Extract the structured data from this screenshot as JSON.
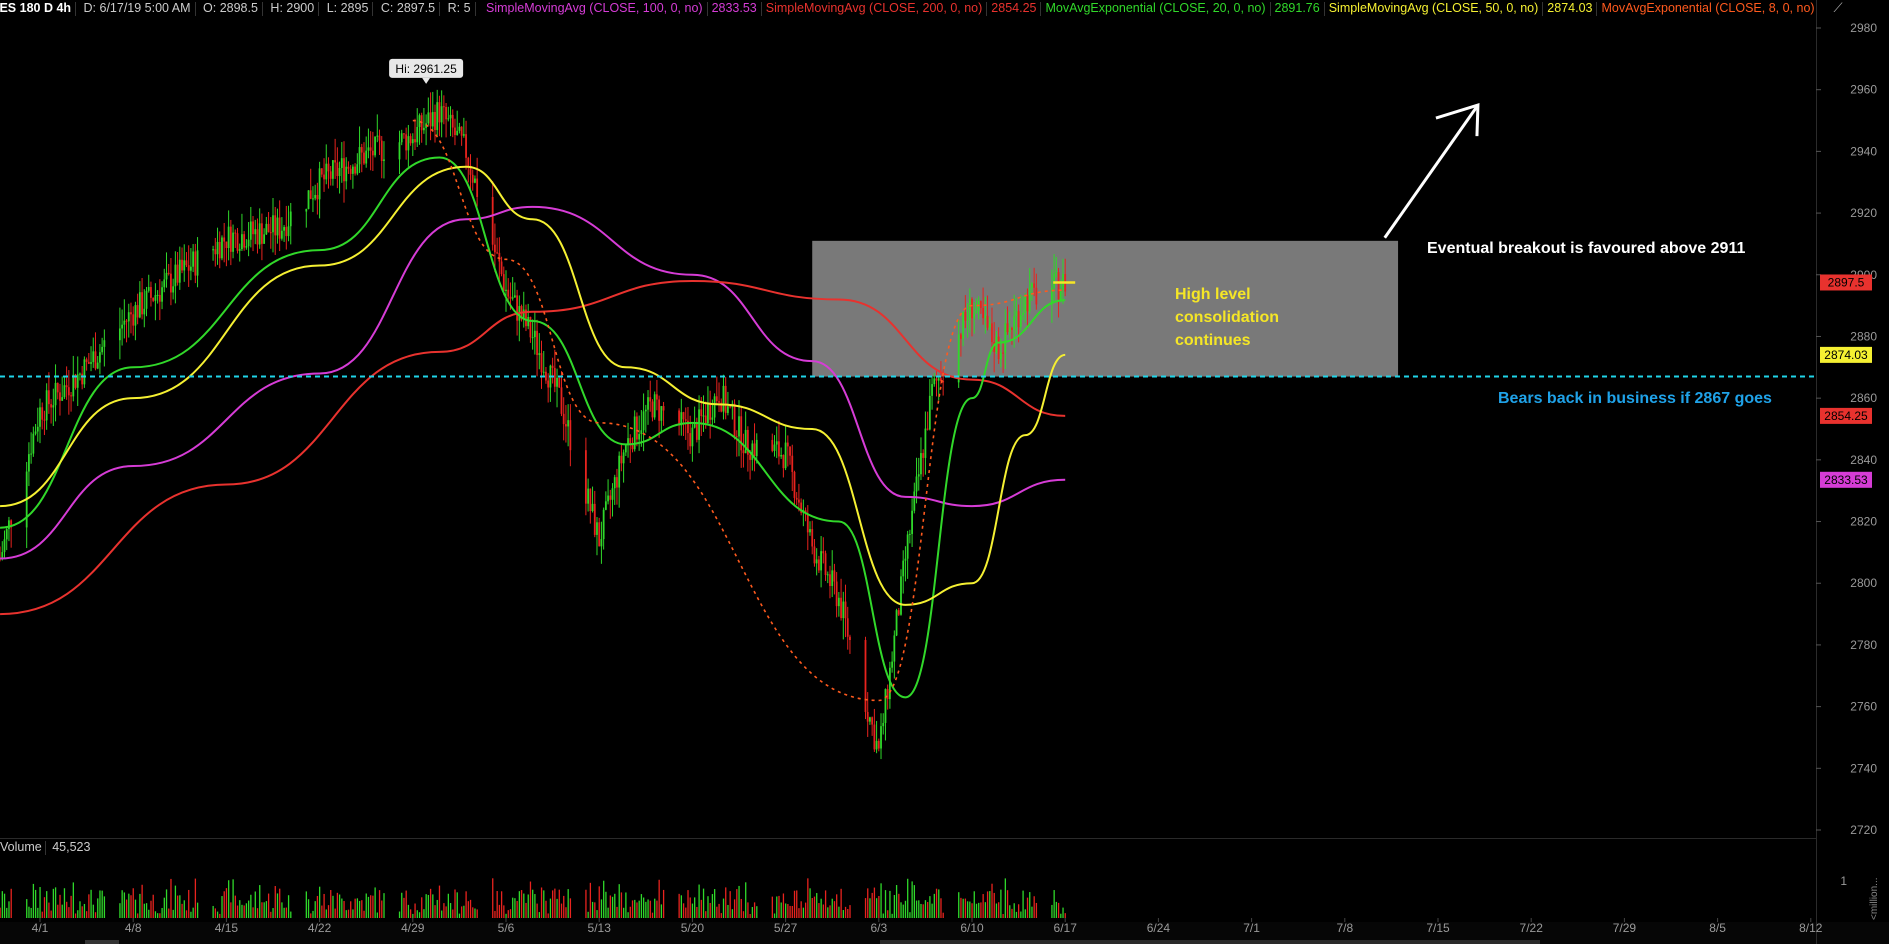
{
  "header": {
    "symbol": "/ES 180 D 4h",
    "date": "D: 6/17/19 5:00 AM",
    "open": "O: 2898.5",
    "high": "H: 2900",
    "low": "L: 2895",
    "close": "C: 2897.5",
    "range": "R: 5",
    "studies": [
      {
        "label": "SimpleMovingAvg (CLOSE, 100, 0, no)",
        "value": "2833.53",
        "color": "#d63cd6"
      },
      {
        "label": "SimpleMovingAvg (CLOSE, 200, 0, no)",
        "value": "2854.25",
        "color": "#e8322e"
      },
      {
        "label": "MovAvgExponential (CLOSE, 20, 0, no)",
        "value": "2891.76",
        "color": "#31d82a"
      },
      {
        "label": "SimpleMovingAvg (CLOSE, 50, 0, no)",
        "value": "2874.03",
        "color": "#f5f032"
      },
      {
        "label": "MovAvgExponential (CLOSE, 8, 0, no)",
        "value": "",
        "color": "#ff5a1e"
      }
    ]
  },
  "volume": {
    "label": "Volume",
    "value": "45,523",
    "unit": "<million..."
  },
  "colors": {
    "up": "#2fd82a",
    "down": "#e8231e",
    "zone": "#808080",
    "support": "#1fd4e8",
    "annotation": "#f5e626"
  },
  "chart_data": {
    "type": "candlestick",
    "timeframe": "4h",
    "ylim": [
      2720,
      2980
    ],
    "y_ticks": [
      2720,
      2740,
      2760,
      2780,
      2800,
      2820,
      2840,
      2860,
      2880,
      2900,
      2920,
      2940,
      2960,
      2980
    ],
    "x_tick_labels": [
      "4/1",
      "4/8",
      "4/15",
      "4/22",
      "4/29",
      "5/6",
      "5/13",
      "5/20",
      "5/27",
      "6/3",
      "6/10",
      "6/17",
      "6/24",
      "7/1",
      "7/8",
      "7/15",
      "7/22",
      "7/29",
      "8/5",
      "8/12"
    ],
    "price_path": {
      "dates": [
        "3/29",
        "4/1",
        "4/4",
        "4/8",
        "4/12",
        "4/15",
        "4/19",
        "4/22",
        "4/25",
        "4/29",
        "5/1",
        "5/3",
        "5/6",
        "5/8",
        "5/10",
        "5/13",
        "5/15",
        "5/17",
        "5/20",
        "5/22",
        "5/24",
        "5/27",
        "5/29",
        "5/31",
        "6/3",
        "6/5",
        "6/7",
        "6/10",
        "6/12",
        "6/14",
        "6/17"
      ],
      "close": [
        2808,
        2856,
        2868,
        2888,
        2902,
        2912,
        2915,
        2930,
        2938,
        2945,
        2953,
        2940,
        2895,
        2880,
        2860,
        2814,
        2845,
        2858,
        2848,
        2862,
        2845,
        2842,
        2812,
        2795,
        2745,
        2808,
        2862,
        2890,
        2876,
        2892,
        2897.5
      ]
    },
    "studies": [
      {
        "name": "SimpleMovingAvg (CLOSE, 100, 0, no)",
        "last": 2833.53,
        "points": [
          [
            "3/29",
            2808
          ],
          [
            "4/8",
            2838
          ],
          [
            "4/22",
            2868
          ],
          [
            "5/3",
            2918
          ],
          [
            "5/8",
            2922
          ],
          [
            "5/20",
            2900
          ],
          [
            "5/29",
            2872
          ],
          [
            "6/5",
            2828
          ],
          [
            "6/10",
            2825
          ],
          [
            "6/17",
            2833.53
          ]
        ]
      },
      {
        "name": "SimpleMovingAvg (CLOSE, 200, 0, no)",
        "last": 2854.25,
        "points": [
          [
            "3/29",
            2790
          ],
          [
            "4/15",
            2832
          ],
          [
            "5/1",
            2875
          ],
          [
            "5/8",
            2888
          ],
          [
            "5/20",
            2898
          ],
          [
            "5/31",
            2892
          ],
          [
            "6/10",
            2866
          ],
          [
            "6/17",
            2854.25
          ]
        ]
      },
      {
        "name": "MovAvgExponential (CLOSE, 20, 0, no)",
        "last": 2891.76,
        "points": [
          [
            "3/29",
            2818
          ],
          [
            "4/8",
            2870
          ],
          [
            "4/22",
            2908
          ],
          [
            "5/1",
            2938
          ],
          [
            "5/8",
            2885
          ],
          [
            "5/15",
            2845
          ],
          [
            "5/20",
            2852
          ],
          [
            "5/31",
            2820
          ],
          [
            "6/5",
            2763
          ],
          [
            "6/10",
            2860
          ],
          [
            "6/12",
            2878
          ],
          [
            "6/17",
            2891.76
          ]
        ]
      },
      {
        "name": "SimpleMovingAvg (CLOSE, 50, 0, no)",
        "last": 2874.03,
        "points": [
          [
            "3/29",
            2825
          ],
          [
            "4/8",
            2860
          ],
          [
            "4/22",
            2903
          ],
          [
            "5/3",
            2935
          ],
          [
            "5/8",
            2918
          ],
          [
            "5/15",
            2870
          ],
          [
            "5/22",
            2858
          ],
          [
            "5/29",
            2850
          ],
          [
            "6/5",
            2793
          ],
          [
            "6/10",
            2800
          ],
          [
            "6/14",
            2848
          ],
          [
            "6/17",
            2874.03
          ]
        ]
      },
      {
        "name": "MovAvgExponential (CLOSE, 8, 0, no)",
        "last": null,
        "points": [
          [
            "4/29",
            2950
          ],
          [
            "5/6",
            2905
          ],
          [
            "5/13",
            2852
          ],
          [
            "6/3",
            2762
          ],
          [
            "6/10",
            2890
          ],
          [
            "6/17",
            2895
          ]
        ]
      }
    ],
    "price_labels": [
      {
        "value": 2897.5,
        "text": "2897.5",
        "color": "#e8322e"
      },
      {
        "value": 2874.03,
        "text": "2874.03",
        "color": "#f5f032"
      },
      {
        "value": 2854.25,
        "text": "2854.25",
        "color": "#e8322e"
      },
      {
        "value": 2833.53,
        "text": "2833.53",
        "color": "#d63cd6"
      }
    ],
    "high_marker": {
      "date": "4/30",
      "value": 2961.25,
      "text": "Hi: 2961.25"
    },
    "consolidation_zone": {
      "from": "5/29",
      "to": "7/12",
      "y_low": 2867,
      "y_high": 2911
    },
    "support_line": {
      "value": 2867
    },
    "annotations": [
      {
        "text": "Eventual breakout is favoured  above 2911",
        "color": "#ffffff"
      },
      {
        "text": "Bears back in business if 2867 goes",
        "color": "#1fa2e8"
      },
      {
        "lines": [
          "High level",
          "consolidation",
          "continues"
        ],
        "color": "#f5e626"
      }
    ],
    "arrow": {
      "from_date": "7/11",
      "to_date": "7/18",
      "from": 2912,
      "to": 2955
    }
  }
}
